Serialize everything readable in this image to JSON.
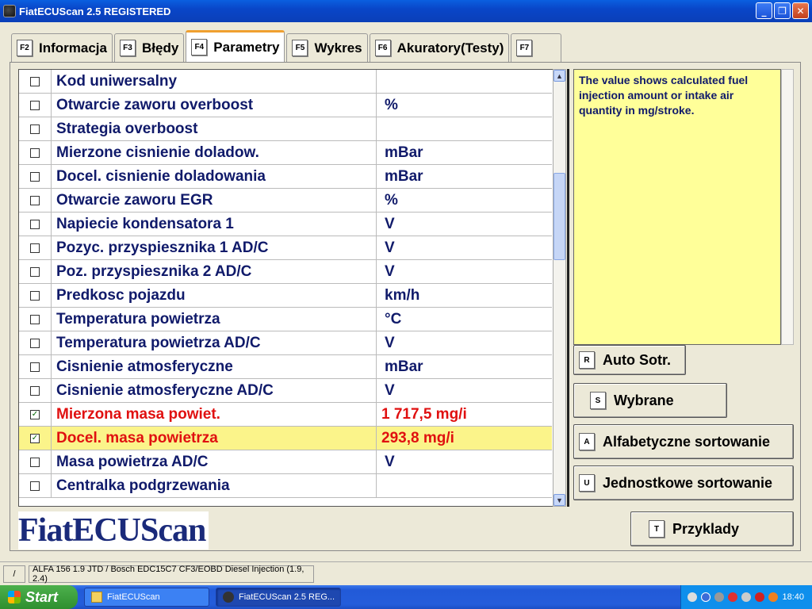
{
  "window": {
    "title": "FiatECUScan 2.5 REGISTERED",
    "minimize": "_",
    "maximize": "❐",
    "close": "✕"
  },
  "tabs": [
    {
      "key": "F2",
      "label": "Informacja"
    },
    {
      "key": "F3",
      "label": "Błędy"
    },
    {
      "key": "F4",
      "label": "Parametry",
      "active": true
    },
    {
      "key": "F5",
      "label": "Wykres"
    },
    {
      "key": "F6",
      "label": "Akuratory(Testy)"
    },
    {
      "key": "F7",
      "label": ""
    }
  ],
  "parameters": [
    {
      "name": "Kod uniwersalny",
      "unit": "",
      "checked": false
    },
    {
      "name": "Otwarcie zaworu overboost",
      "unit": "%",
      "checked": false
    },
    {
      "name": "Strategia overboost",
      "unit": "",
      "checked": false
    },
    {
      "name": "Mierzone cisnienie doladow.",
      "unit": "mBar",
      "checked": false
    },
    {
      "name": "Docel. cisnienie doladowania",
      "unit": "mBar",
      "checked": false
    },
    {
      "name": "Otwarcie zaworu EGR",
      "unit": "%",
      "checked": false
    },
    {
      "name": "Napiecie kondensatora 1",
      "unit": "V",
      "checked": false
    },
    {
      "name": "Pozyc. przyspiesznika 1 AD/C",
      "unit": "V",
      "checked": false
    },
    {
      "name": "Poz. przyspiesznika 2 AD/C",
      "unit": "V",
      "checked": false
    },
    {
      "name": "Predkosc pojazdu",
      "unit": "km/h",
      "checked": false
    },
    {
      "name": "Temperatura powietrza",
      "unit": "°C",
      "checked": false
    },
    {
      "name": "Temperatura powietrza AD/C",
      "unit": "V",
      "checked": false
    },
    {
      "name": "Cisnienie atmosferyczne",
      "unit": "mBar",
      "checked": false
    },
    {
      "name": "Cisnienie atmosferyczne AD/C",
      "unit": "V",
      "checked": false
    },
    {
      "name": "Mierzona masa powiet.",
      "unit": "1 717,5 mg/i",
      "checked": true,
      "active": true
    },
    {
      "name": "Docel. masa powietrza",
      "unit": "293,8 mg/i",
      "checked": true,
      "active": true,
      "selected": true
    },
    {
      "name": "Masa powietrza AD/C",
      "unit": "V",
      "checked": false
    },
    {
      "name": "Centralka podgrzewania",
      "unit": "",
      "checked": false
    }
  ],
  "description": "The value shows calculated fuel injection amount or intake air quantity in mg/stroke.",
  "buttons": [
    {
      "key": "R",
      "label": "Auto Sotr."
    },
    {
      "key": "S",
      "label": "Wybrane"
    },
    {
      "key": "A",
      "label": "Alfabetyczne sortowanie"
    },
    {
      "key": "U",
      "label": "Jednostkowe sortowanie"
    },
    {
      "key": "T",
      "label": "Przyklady"
    }
  ],
  "logo": "FiatECUScan",
  "status": {
    "slash": "/",
    "vehicle": "ALFA 156 1.9 JTD / Bosch EDC15C7 CF3/EOBD Diesel Injection (1.9, 2.4)"
  },
  "taskbar": {
    "start": "Start",
    "tasks": [
      {
        "label": "FiatECUScan"
      },
      {
        "label": "FiatECUScan 2.5 REG..."
      }
    ],
    "clock": "18:40"
  },
  "colors": {
    "active_param": "#e01010",
    "param_text": "#101a6a",
    "highlight_row": "#fbf48a",
    "description_bg": "#ffff99"
  }
}
